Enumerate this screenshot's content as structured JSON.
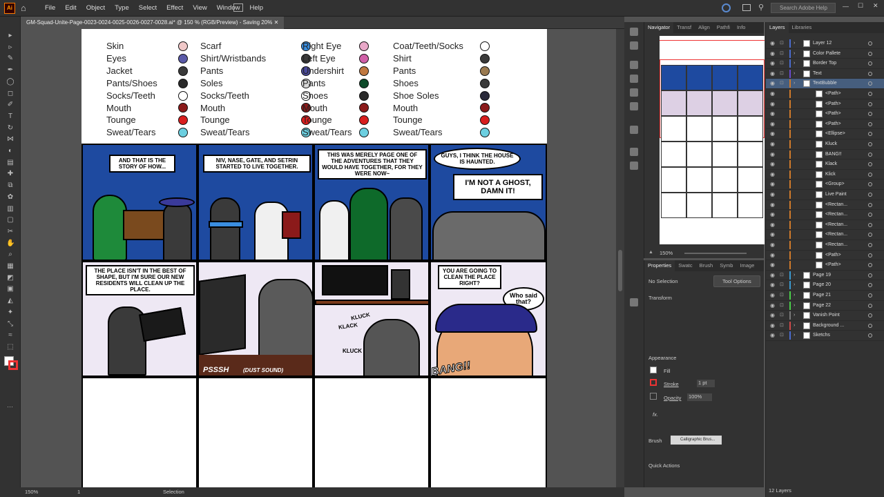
{
  "app": {
    "name": "Adobe Illustrator",
    "logo_text": "Ai"
  },
  "menu": [
    "File",
    "Edit",
    "Object",
    "Type",
    "Select",
    "Effect",
    "View",
    "Window",
    "Help"
  ],
  "search_placeholder": "Search Adobe Help",
  "document_tab": "GM-Squad-Unite-Page-0023-0024-0025-0026-0027-0028.ai* @ 150 % (RGB/Preview) - Saving 20%",
  "status": {
    "zoom": "150%",
    "artboard": "1",
    "tool": "Selection"
  },
  "legend": [
    {
      "items": [
        [
          "Skin",
          "#f0c8c8"
        ],
        [
          "Eyes",
          "#5a5aa8"
        ],
        [
          "Jacket",
          "#3a3a3a"
        ],
        [
          "Pants/Shoes",
          "#2a2a2a"
        ],
        [
          "Socks/Teeth",
          "#ffffff"
        ],
        [
          "Mouth",
          "#8b1a1a"
        ],
        [
          "Tounge",
          "#d81e1e"
        ],
        [
          "Sweat/Tears",
          "#6ccfe0"
        ]
      ]
    },
    {
      "items": [
        [
          "Scarf",
          "#3a8ee0"
        ],
        [
          "Shirt/Wristbands",
          "#3a3a3a"
        ],
        [
          "Pants",
          "#4a4a9a"
        ],
        [
          "Soles",
          "#d8d8d8"
        ],
        [
          "Socks/Teeth",
          "#ffffff"
        ],
        [
          "Mouth",
          "#8b1a1a"
        ],
        [
          "Tounge",
          "#d81e1e"
        ],
        [
          "Sweat/Tears",
          "#6ccfe0"
        ]
      ]
    },
    {
      "items": [
        [
          "Right Eye",
          "#e8a8c8"
        ],
        [
          "Left Eye",
          "#d060a8"
        ],
        [
          "Undershirt",
          "#c07840"
        ],
        [
          "Pants",
          "#0e4a2a"
        ],
        [
          "Shoes",
          "#2a2a2a"
        ],
        [
          "Mouth",
          "#8b1a1a"
        ],
        [
          "Tounge",
          "#d81e1e"
        ],
        [
          "Sweat/Tears",
          "#6ccfe0"
        ]
      ]
    },
    {
      "items": [
        [
          "Coat/Teeth/Socks",
          "#ffffff"
        ],
        [
          "Shirt",
          "#3a3a3a"
        ],
        [
          "Pants",
          "#9a7a50"
        ],
        [
          "Shoes",
          "#3a3a3a"
        ],
        [
          "Shoe Soles",
          "#2a2a3a"
        ],
        [
          "Mouth",
          "#8b1a1a"
        ],
        [
          "Tounge",
          "#d81e1e"
        ],
        [
          "Sweat/Tears",
          "#6ccfe0"
        ]
      ]
    }
  ],
  "comic": {
    "p1": "And that is the story of how...",
    "p2": "Niv, Nase, Gate, and Setrin started to live together.",
    "p3": "This was merely page one of the adventures that they would have together, for they were now~",
    "p4a": "Guys, I think the house is haunted.",
    "p4b": "I'm not a ghost, damn it!",
    "p5": "The place isn't in the best of shape, but I'm sure our new residents will clean up the place.",
    "p6": "PSSSH",
    "p6b": "(dust sound)",
    "p7a": "KLUCK",
    "p7b": "KLACK",
    "p7c": "KLUCK",
    "p8a": "You are going to clean the place right?",
    "p8b": "Who said that?",
    "p8c": "BANG!!"
  },
  "nav_tabs": [
    "Navigator",
    "Transf",
    "Align",
    "Pathfi",
    "Info"
  ],
  "nav_zoom": "150%",
  "props_tabs": [
    "Properties",
    "Swatc",
    "Brush",
    "Symb",
    "Image"
  ],
  "props": {
    "selection": "No Selection",
    "tool_options": "Tool Options",
    "transform": "Transform",
    "appearance": "Appearance",
    "fill": "Fill",
    "stroke": "Stroke",
    "stroke_val": "1 pt",
    "opacity": "Opacity",
    "opacity_val": "100%",
    "fx": "fx.",
    "brush": "Brush",
    "brush_val": "Calligraphic Brus...",
    "quick_actions": "Quick Actions"
  },
  "layers_tabs": [
    "Layers",
    "Libraries"
  ],
  "layers": [
    {
      "name": "Layer 12",
      "color": "#4a6cd0",
      "indent": 0
    },
    {
      "name": "Color Pallete",
      "color": "#4a6cd0",
      "indent": 0
    },
    {
      "name": "Border Top",
      "color": "#4a6cd0",
      "indent": 0
    },
    {
      "name": "Text",
      "color": "#6a4ad0",
      "indent": 0
    },
    {
      "name": "TextBubble",
      "color": "#d07a2a",
      "indent": 0,
      "sel": true
    },
    {
      "name": "<Path>",
      "color": "#d07a2a",
      "indent": 1
    },
    {
      "name": "<Path>",
      "color": "#d07a2a",
      "indent": 1
    },
    {
      "name": "<Path>",
      "color": "#d07a2a",
      "indent": 1
    },
    {
      "name": "<Path>",
      "color": "#d07a2a",
      "indent": 1
    },
    {
      "name": "<Ellipse>",
      "color": "#d07a2a",
      "indent": 1
    },
    {
      "name": "Kluck",
      "color": "#d07a2a",
      "indent": 1
    },
    {
      "name": "BANG!!",
      "color": "#d07a2a",
      "indent": 1
    },
    {
      "name": "Klack",
      "color": "#d07a2a",
      "indent": 1
    },
    {
      "name": "Klick",
      "color": "#d07a2a",
      "indent": 1
    },
    {
      "name": "<Group>",
      "color": "#d07a2a",
      "indent": 1
    },
    {
      "name": "Live Paint",
      "color": "#d07a2a",
      "indent": 1
    },
    {
      "name": "<Rectan...",
      "color": "#d07a2a",
      "indent": 1
    },
    {
      "name": "<Rectan...",
      "color": "#d07a2a",
      "indent": 1
    },
    {
      "name": "<Rectan...",
      "color": "#d07a2a",
      "indent": 1
    },
    {
      "name": "<Rectan...",
      "color": "#d07a2a",
      "indent": 1
    },
    {
      "name": "<Rectan...",
      "color": "#d07a2a",
      "indent": 1
    },
    {
      "name": "<Path>",
      "color": "#d07a2a",
      "indent": 1
    },
    {
      "name": "<Path>",
      "color": "#d07a2a",
      "indent": 1
    },
    {
      "name": "Page 19",
      "color": "#3a9ad0",
      "indent": 0
    },
    {
      "name": "Page 20",
      "color": "#3a9ad0",
      "indent": 0
    },
    {
      "name": "Page 21",
      "color": "#4ad04a",
      "indent": 0
    },
    {
      "name": "Page 22",
      "color": "#4ad04a",
      "indent": 0
    },
    {
      "name": "Vanish Point",
      "color": "#7a7a7a",
      "indent": 0
    },
    {
      "name": "Background ...",
      "color": "#d04a4a",
      "indent": 0
    },
    {
      "name": "Sketchs",
      "color": "#4a6cd0",
      "indent": 0
    }
  ],
  "layers_count": "12 Layers"
}
